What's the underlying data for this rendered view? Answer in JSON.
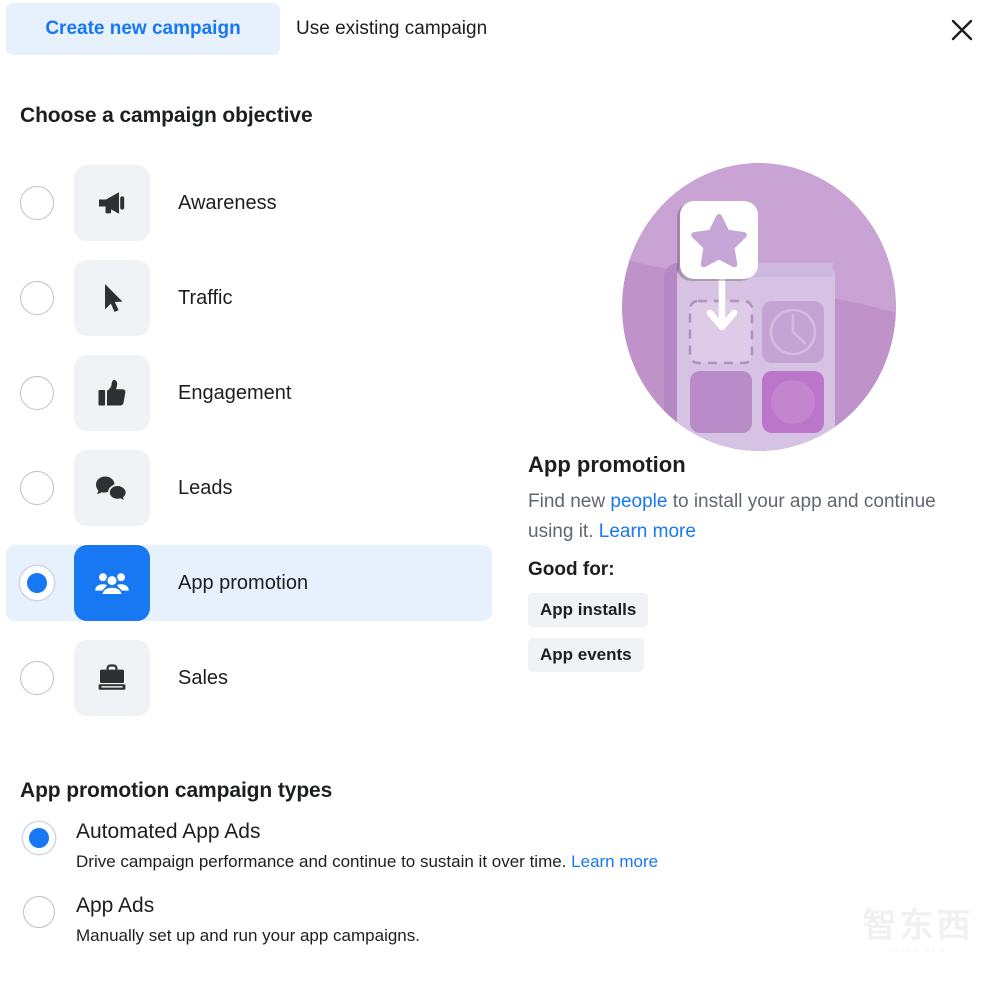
{
  "header": {
    "tabs": [
      {
        "label": "Create new campaign",
        "active": true
      },
      {
        "label": "Use existing campaign",
        "active": false
      }
    ],
    "close_icon": "close-icon",
    "accent_color": "#1877f2",
    "active_tab_bg": "#e7f0fd"
  },
  "objective_section": {
    "title": "Choose a campaign objective",
    "items": [
      {
        "label": "Awareness",
        "icon": "megaphone-icon",
        "selected": false
      },
      {
        "label": "Traffic",
        "icon": "cursor-icon",
        "selected": false
      },
      {
        "label": "Engagement",
        "icon": "thumbs-up-icon",
        "selected": false
      },
      {
        "label": "Leads",
        "icon": "speech-bubbles-icon",
        "selected": false
      },
      {
        "label": "App promotion",
        "icon": "people-group-icon",
        "selected": true
      },
      {
        "label": "Sales",
        "icon": "briefcase-icon",
        "selected": false
      }
    ]
  },
  "detail_panel": {
    "illustration": "app-promotion-illustration",
    "illustration_colors": {
      "circle": "#c49cd0",
      "circle_light": "#cdaad8",
      "phone_body": "#d9c4e4",
      "card": "#ffffff",
      "star": "#c6a6d6",
      "tile_solid": "#bb76c9",
      "tile_mid": "#b98cc9"
    },
    "title": "App promotion",
    "description_parts": {
      "before_link": "Find new ",
      "link1": "people",
      "middle": " to install your app and continue using it. ",
      "link2": "Learn more"
    },
    "good_for_label": "Good for:",
    "chips": [
      "App installs",
      "App events"
    ]
  },
  "types_section": {
    "title": "App promotion campaign types",
    "options": [
      {
        "label": "Automated App Ads",
        "description": "Drive campaign performance and continue to sustain it over time.",
        "link": "Learn more",
        "selected": true
      },
      {
        "label": "App Ads",
        "description": "Manually set up and run your app campaigns.",
        "link": "",
        "selected": false
      }
    ]
  },
  "watermark": {
    "text": "智东西",
    "subtext": "zhidx.com"
  }
}
